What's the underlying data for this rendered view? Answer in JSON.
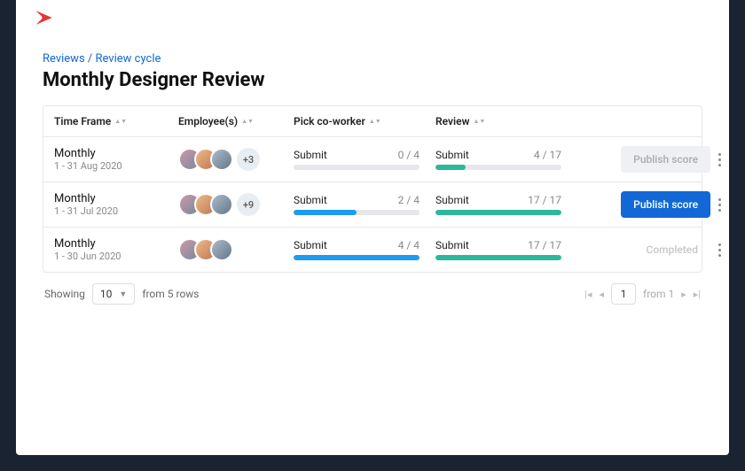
{
  "breadcrumb": {
    "root": "Reviews",
    "current": "Review cycle"
  },
  "title": "Monthly Designer Review",
  "columns": {
    "timeframe": "Time Frame",
    "employees": "Employee(s)",
    "pick": "Pick co-worker",
    "review": "Review"
  },
  "rows": [
    {
      "period": "Monthly",
      "range": "1 - 31 Aug 2020",
      "extra": "+3",
      "pick": {
        "label": "Submit",
        "count": "0 / 4",
        "done": 0,
        "total": 4
      },
      "review": {
        "label": "Submit",
        "count": "4 / 17",
        "done": 4,
        "total": 17
      },
      "action": "Publish score",
      "action_state": "disabled"
    },
    {
      "period": "Monthly",
      "range": "1 - 31 Jul 2020",
      "extra": "+9",
      "pick": {
        "label": "Submit",
        "count": "2 / 4",
        "done": 2,
        "total": 4
      },
      "review": {
        "label": "Submit",
        "count": "17 / 17",
        "done": 17,
        "total": 17
      },
      "action": "Publish score",
      "action_state": "primary"
    },
    {
      "period": "Monthly",
      "range": "1 - 30 Jun 2020",
      "extra": "",
      "pick": {
        "label": "Submit",
        "count": "4 / 4",
        "done": 4,
        "total": 4
      },
      "review": {
        "label": "Submit",
        "count": "17 / 17",
        "done": 17,
        "total": 17
      },
      "action": "Completed",
      "action_state": "ghost"
    }
  ],
  "footer": {
    "showing": "Showing",
    "pageSize": "10",
    "fromRows": "from 5 rows",
    "page": "1",
    "fromPages": "from 1"
  },
  "colors": {
    "accent": "#1268d6",
    "blue": "#1d9bf0",
    "teal": "#2db79c",
    "brand": "#e23838"
  }
}
